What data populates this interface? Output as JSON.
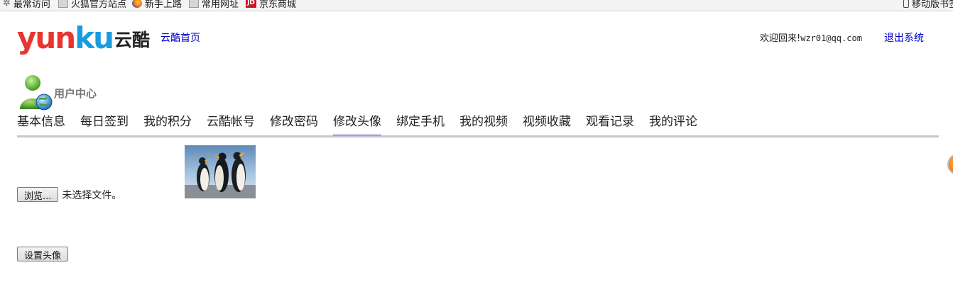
{
  "bookmarks": {
    "items": [
      {
        "label": "最常访问",
        "icon": "gear-icon"
      },
      {
        "label": "火狐官方站点",
        "icon": "folder-icon"
      },
      {
        "label": "新手上路",
        "icon": "firefox-icon"
      },
      {
        "label": "常用网址",
        "icon": "folder-icon"
      },
      {
        "label": "京东商城",
        "icon": "jd-icon"
      }
    ],
    "mobile_label": "移动版书签"
  },
  "header": {
    "logo_en_yun": "yun",
    "logo_en_ku": "ku",
    "logo_cn": "云酷",
    "home_link": "云酷首页",
    "welcome_prefix": "欢迎回来!",
    "welcome_email": "wzr01@qq.com",
    "logout": "退出系统"
  },
  "user_center": {
    "title": "用户中心",
    "tabs": [
      "基本信息",
      "每日签到",
      "我的积分",
      "云酷帐号",
      "修改密码",
      "修改头像",
      "绑定手机",
      "我的视频",
      "视频收藏",
      "观看记录",
      "我的评论"
    ],
    "active_tab": "修改头像"
  },
  "avatar_form": {
    "browse_button": "浏览...",
    "no_file_text": "未选择文件。",
    "set_button": "设置头像"
  },
  "colors": {
    "accent": "#3a3ae0",
    "link": "#0000cc",
    "logo_red": "#e8352e",
    "logo_blue": "#1a9be0"
  }
}
